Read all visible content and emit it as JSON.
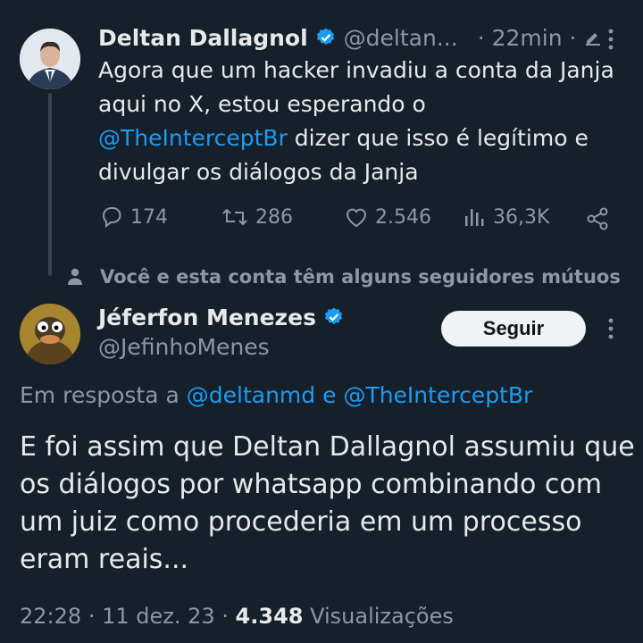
{
  "tweet1": {
    "author_name": "Deltan Dallagnol",
    "author_handle": "@deltan...",
    "time": "· 22min ·",
    "text_line1": "Agora que um hacker invadiu a conta da Janja",
    "text_line2": "aqui no X, estou esperando o",
    "mention": "@TheInterceptBr",
    "text_line3_rest": " dizer que isso é legítimo e",
    "text_line4": "divulgar os diálogos da Janja",
    "replies": "174",
    "retweets": "286",
    "likes": "2.546",
    "views": "36,3K"
  },
  "social_context": "Você e esta conta têm alguns seguidores mútuos",
  "tweet2": {
    "author_name": "Jéferfon Menezes",
    "author_handle": "@JefinhoMenes",
    "follow_label": "Seguir",
    "reply_prefix": "Em resposta a ",
    "reply_mention1": "@deltanmd",
    "reply_joiner": " e ",
    "reply_mention2": "@TheInterceptBr",
    "text_line1": "E foi assim que Deltan Dallagnol assumiu que",
    "text_line2": "os diálogos por whatsapp combinando com",
    "text_line3": "um juiz como procederia em um processo",
    "text_line4": "eram reais...",
    "time": "22:28",
    "date": "11 dez. 23",
    "views_count": "4.348",
    "views_label": "Visualizações"
  },
  "colors": {
    "background": "#15202b",
    "link": "#1d9bf0",
    "verified": "#1d9bf0",
    "muted": "#8b98a5"
  },
  "icons": [
    "verified-badge-icon",
    "edit-pencil-icon",
    "more-icon",
    "reply-icon",
    "retweet-icon",
    "like-icon",
    "views-icon",
    "share-icon",
    "person-icon"
  ]
}
